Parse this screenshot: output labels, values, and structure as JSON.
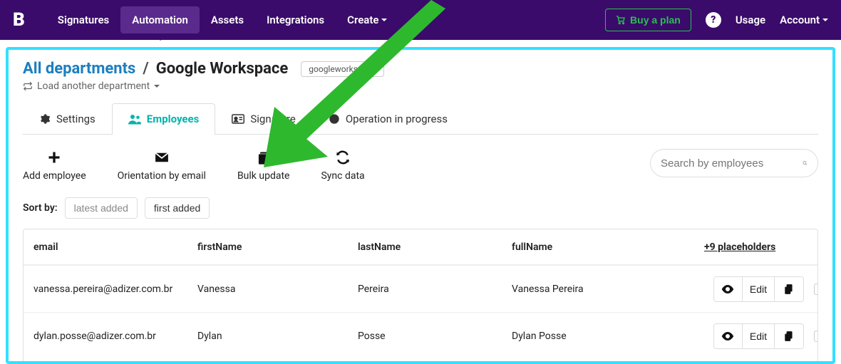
{
  "nav": {
    "logo": "B",
    "items": [
      "Signatures",
      "Automation",
      "Assets",
      "Integrations",
      "Create"
    ],
    "active_index": 1,
    "buy_plan": "Buy a plan",
    "usage": "Usage",
    "account": "Account"
  },
  "breadcrumb": {
    "root": "All departments",
    "current": "Google Workspace",
    "slug": "googleworkspace",
    "load_another": "Load another department"
  },
  "tabs": {
    "items": [
      "Settings",
      "Employees",
      "Signature",
      "Operation in progress"
    ],
    "active_index": 1
  },
  "actions": {
    "add_employee": "Add employee",
    "orientation": "Orientation by email",
    "bulk_update": "Bulk update",
    "sync_data": "Sync data"
  },
  "search": {
    "placeholder": "Search by employees"
  },
  "sort": {
    "label": "Sort by:",
    "latest": "latest added",
    "first": "first added"
  },
  "table": {
    "headers": {
      "email": "email",
      "first": "firstName",
      "last": "lastName",
      "full": "fullName",
      "placeholders": "+9 placeholders"
    },
    "rows": [
      {
        "email": "vanessa.pereira@adizer.com.br",
        "first": "Vanessa",
        "last": "Pereira",
        "full": "Vanessa Pereira",
        "edit": "Edit"
      },
      {
        "email": "dylan.posse@adizer.com.br",
        "first": "Dylan",
        "last": "Posse",
        "full": "Dylan Posse",
        "edit": "Edit"
      }
    ]
  }
}
